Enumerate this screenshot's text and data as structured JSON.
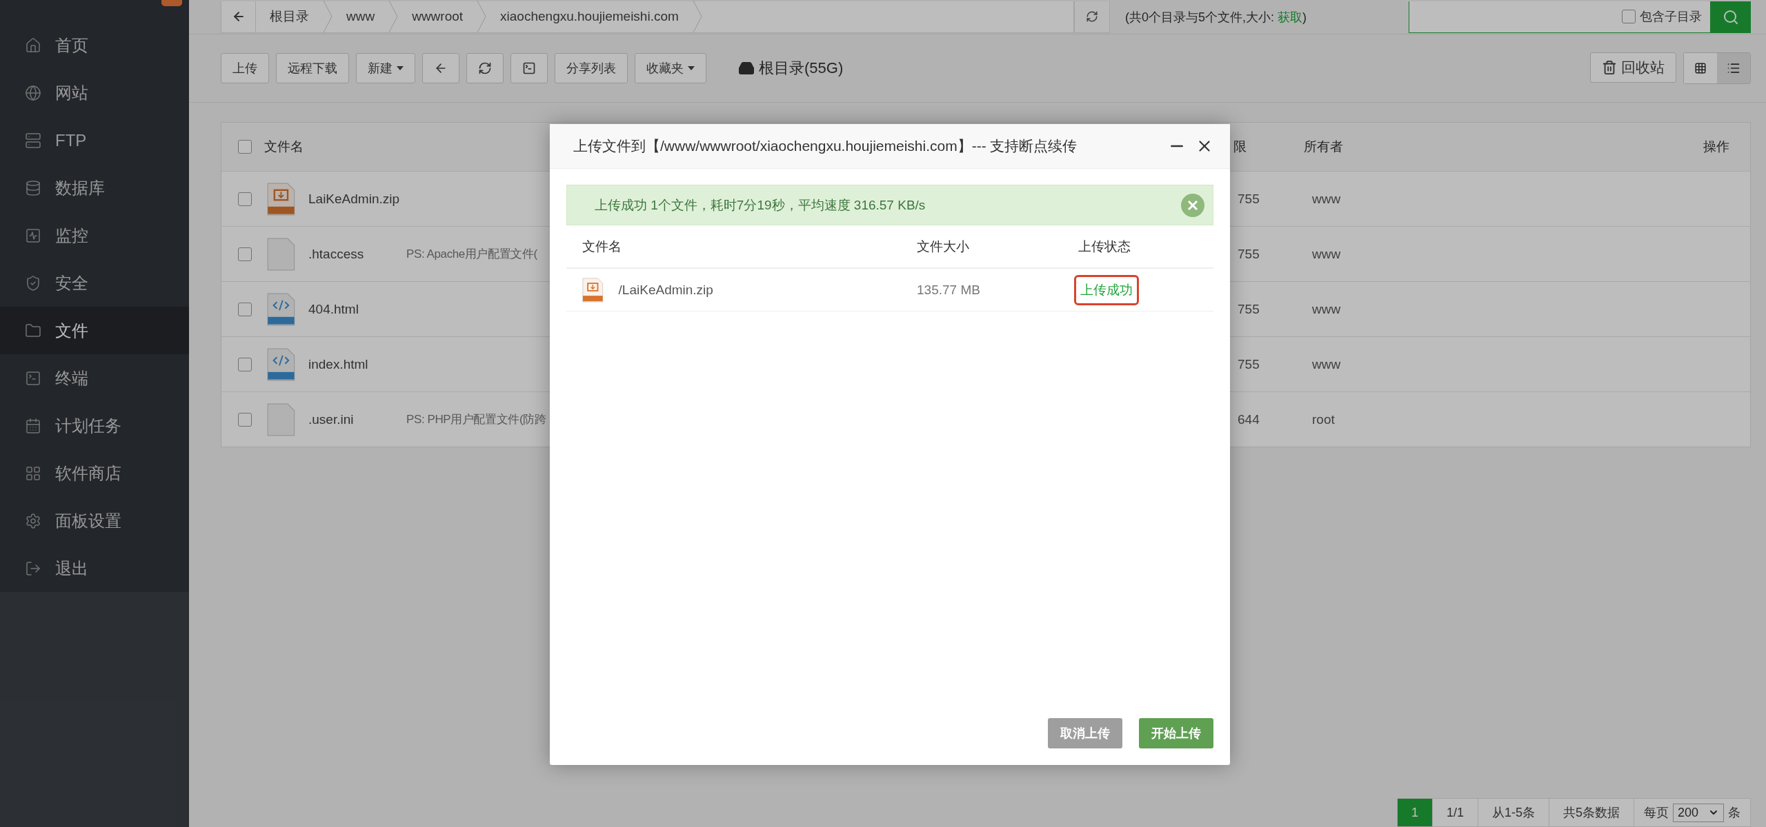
{
  "sidebar": {
    "items": [
      {
        "label": "首页",
        "selected": false
      },
      {
        "label": "网站",
        "selected": false
      },
      {
        "label": "FTP",
        "selected": false
      },
      {
        "label": "数据库",
        "selected": false
      },
      {
        "label": "监控",
        "selected": false
      },
      {
        "label": "安全",
        "selected": false
      },
      {
        "label": "文件",
        "selected": true
      },
      {
        "label": "终端",
        "selected": false
      },
      {
        "label": "计划任务",
        "selected": false
      },
      {
        "label": "软件商店",
        "selected": false
      },
      {
        "label": "面板设置",
        "selected": false
      },
      {
        "label": "退出",
        "selected": false
      }
    ]
  },
  "breadcrumb": {
    "segments": [
      "根目录",
      "www",
      "wwwroot",
      "xiaochengxu.houjiemeishi.com"
    ]
  },
  "summary": {
    "text": "(共0个目录与5个文件,大小:",
    "link": "获取",
    "end": ")"
  },
  "search": {
    "option_label": "包含子目录",
    "checked": false
  },
  "toolbar": {
    "buttons": [
      {
        "kind": "text",
        "label": "上传"
      },
      {
        "kind": "text",
        "label": "远程下载"
      },
      {
        "kind": "dropdown",
        "label": "新建"
      },
      {
        "kind": "icon"
      },
      {
        "kind": "icon"
      },
      {
        "kind": "icon"
      },
      {
        "kind": "text",
        "label": "分享列表"
      },
      {
        "kind": "dropdown",
        "label": "收藏夹"
      }
    ],
    "disk": "根目录(55G)",
    "recycle": "回收站",
    "views": [
      {
        "selected": false
      },
      {
        "selected": true
      }
    ]
  },
  "table": {
    "header_checked": false,
    "columns": [
      "文件名",
      "限",
      "所有者",
      "操作"
    ],
    "rows": [
      {
        "kind": "zip",
        "name": "LaiKeAdmin.zip",
        "permission": "755",
        "owner": "www",
        "checked": false
      },
      {
        "kind": "blank",
        "name": ".htaccess",
        "description": "PS: Apache用户配置文件(",
        "permission": "755",
        "owner": "www",
        "checked": false
      },
      {
        "kind": "html",
        "name": "404.html",
        "permission": "755",
        "owner": "www",
        "checked": false
      },
      {
        "kind": "html",
        "name": "index.html",
        "permission": "755",
        "owner": "www",
        "checked": false
      },
      {
        "kind": "blank",
        "name": ".user.ini",
        "description": "PS: PHP用户配置文件(防跨",
        "permission": "644",
        "owner": "root",
        "checked": false
      }
    ]
  },
  "modal": {
    "title": "上传文件到【/www/wwwroot/xiaochengxu.houjiemeishi.com】--- 支持断点续传",
    "alert": "上传成功 1个文件，耗时7分19秒，平均速度 316.57 KB/s",
    "columns": [
      "文件名",
      "文件大小",
      "上传状态"
    ],
    "files": [
      {
        "kind": "zip",
        "name": "/LaiKeAdmin.zip",
        "size": "135.77 MB",
        "status": "上传成功",
        "highlighted": true
      }
    ],
    "buttons": [
      {
        "label": "取消上传",
        "disabled": true
      },
      {
        "label": "开始上传",
        "disabled": false
      }
    ]
  },
  "pagination": {
    "current": "1",
    "pages": "1/1",
    "range": "从1-5条",
    "total": "共5条数据",
    "per_page_label": "每页",
    "per_page": "200",
    "unit": "条"
  }
}
